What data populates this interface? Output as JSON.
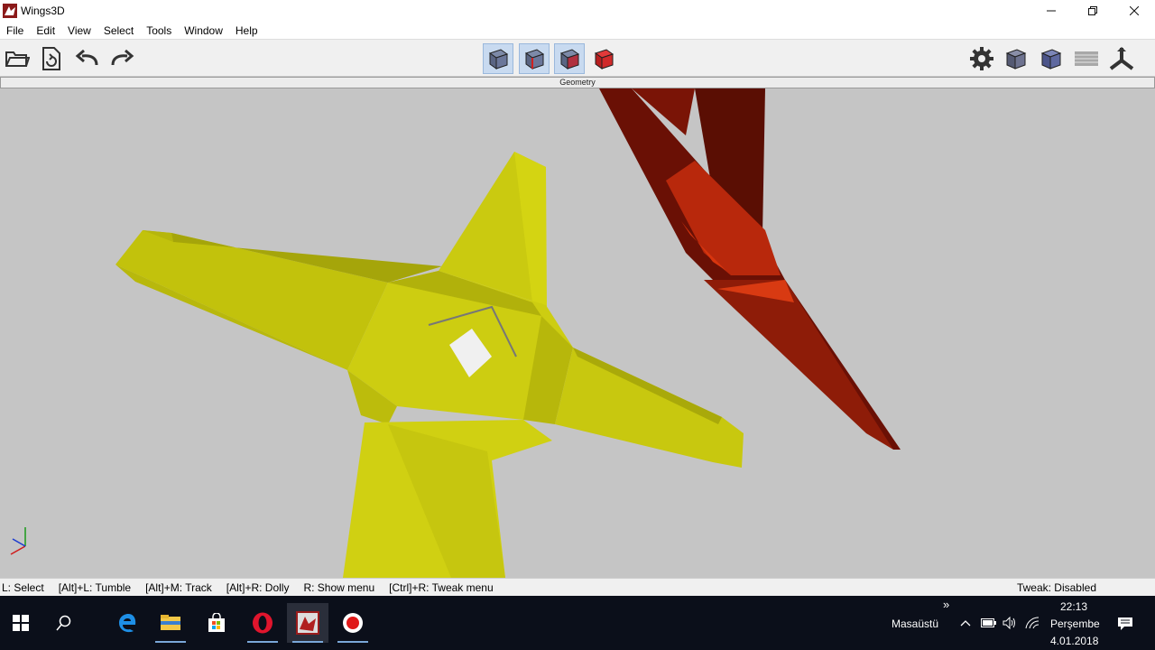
{
  "window": {
    "title": "Wings3D"
  },
  "menu": [
    "File",
    "Edit",
    "View",
    "Select",
    "Tools",
    "Window",
    "Help"
  ],
  "geometry_header": "Geometry",
  "status": {
    "items": [
      "L: Select",
      "[Alt]+L: Tumble",
      "[Alt]+M: Track",
      "[Alt]+R: Dolly",
      "R: Show menu",
      "[Ctrl]+R: Tweak menu"
    ],
    "right": "Tweak: Disabled"
  },
  "taskbar": {
    "desktop_label": "Masaüstü",
    "time": "22:13",
    "day": "Perşembe",
    "date": "4.01.2018",
    "chevron": "»"
  },
  "colors": {
    "viewport_bg": "#c5c5c5",
    "yellow_object": "#cfcf10",
    "red_object": "#b02a0a",
    "taskbar_bg": "#0b0f1a",
    "select_bg": "#c8daf0"
  }
}
